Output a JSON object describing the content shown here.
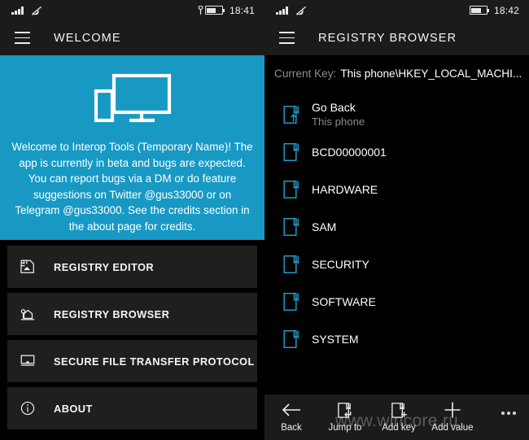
{
  "left": {
    "status": {
      "time": "18:41",
      "signal_icon": "signal-bars-icon",
      "wifi_icon": "wifi-icon",
      "battery_icon": "battery-charging-icon",
      "plug_icon": "plug-icon"
    },
    "header": {
      "menu_icon": "hamburger-menu-icon",
      "title": "WELCOME"
    },
    "hero": {
      "icon": "monitor-and-phone-icon",
      "text": "Welcome to Interop Tools (Temporary Name)! The app is currently in beta and bugs are expected. You can report bugs via a DM or do feature suggestions on Twitter @gus33000 or on Telegram @gus33000. See the credits section in the about page for credits.",
      "background_color": "#1799c4"
    },
    "tiles": [
      {
        "label": "REGISTRY EDITOR",
        "icon": "registry-editor-icon"
      },
      {
        "label": "REGISTRY BROWSER",
        "icon": "registry-browser-icon"
      },
      {
        "label": "SECURE FILE TRANSFER PROTOCOL",
        "icon": "sftp-monitor-icon"
      },
      {
        "label": "ABOUT",
        "icon": "info-circle-icon"
      }
    ]
  },
  "right": {
    "status": {
      "time": "18:42",
      "signal_icon": "signal-bars-icon",
      "wifi_icon": "wifi-icon",
      "battery_icon": "battery-icon"
    },
    "header": {
      "menu_icon": "hamburger-menu-icon",
      "title": "REGISTRY BROWSER"
    },
    "current_key": {
      "label": "Current Key:",
      "value": "This phone\\HKEY_LOCAL_MACHI..."
    },
    "list": [
      {
        "name": "Go Back",
        "sub": "This phone",
        "icon": "folder-up-icon"
      },
      {
        "name": "BCD00000001",
        "sub": "",
        "icon": "registry-key-icon"
      },
      {
        "name": "HARDWARE",
        "sub": "",
        "icon": "registry-key-icon"
      },
      {
        "name": "SAM",
        "sub": "",
        "icon": "registry-key-icon"
      },
      {
        "name": "SECURITY",
        "sub": "",
        "icon": "registry-key-icon"
      },
      {
        "name": "SOFTWARE",
        "sub": "",
        "icon": "registry-key-icon"
      },
      {
        "name": "SYSTEM",
        "sub": "",
        "icon": "registry-key-icon"
      }
    ],
    "commands": [
      {
        "label": "Back",
        "icon": "arrow-left-icon"
      },
      {
        "label": "Jump to",
        "icon": "folder-enter-icon"
      },
      {
        "label": "Add key",
        "icon": "folder-plus-icon"
      },
      {
        "label": "Add value",
        "icon": "plus-icon"
      }
    ],
    "more_icon": "ellipsis-icon"
  },
  "watermark": "www.wincore.ru",
  "colors": {
    "accent_teal": "#1799c4",
    "key_icon_teal": "#1e9bc4",
    "tile_bg": "#1f1f1f",
    "chrome_bg": "#1b1b1b"
  }
}
